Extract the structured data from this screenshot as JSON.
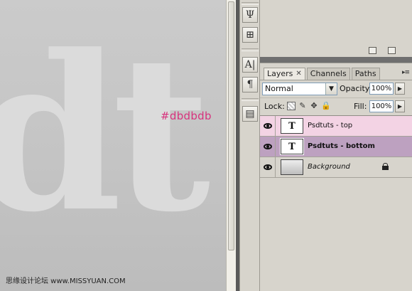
{
  "canvas": {
    "big_text": "dt",
    "color_note": "#dbdbdb",
    "watermark": "思缘设计论坛 www.MISSYUAN.COM"
  },
  "tools": [
    {
      "name": "brush-tool-icon",
      "glyph": "Ψ"
    },
    {
      "name": "clone-source-icon",
      "glyph": "⊞"
    },
    {
      "name": "character-icon",
      "glyph": "A|"
    },
    {
      "name": "paragraph-icon",
      "glyph": "¶"
    },
    {
      "name": "notes-icon",
      "glyph": "▤"
    }
  ],
  "layers_panel": {
    "tabs": [
      {
        "label": "Layers",
        "active": true
      },
      {
        "label": "Channels",
        "active": false
      },
      {
        "label": "Paths",
        "active": false
      }
    ],
    "blend_mode": "Normal",
    "opacity_label": "Opacity:",
    "opacity_value": "100%",
    "lock_label": "Lock:",
    "fill_label": "Fill:",
    "fill_value": "100%",
    "layers": [
      {
        "name": "Psdtuts - top",
        "type": "text",
        "thumb": "T",
        "state": "highlighted",
        "highlight_color": "#f3d3e4"
      },
      {
        "name": "Psdtuts - bottom",
        "type": "text",
        "thumb": "T",
        "state": "selected",
        "highlight_color": "#bda1c0"
      },
      {
        "name": "Background",
        "type": "raster",
        "state": "normal",
        "locked": true
      }
    ]
  }
}
